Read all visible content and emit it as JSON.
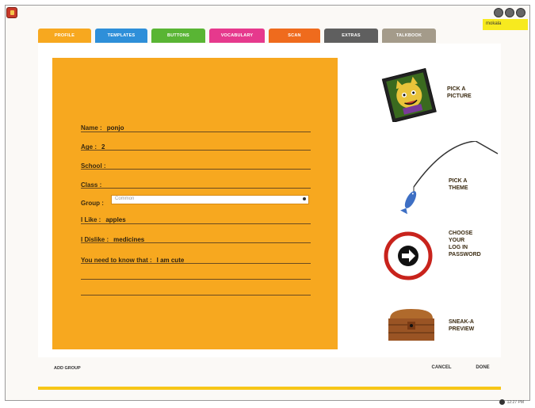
{
  "user": {
    "name": "mokala"
  },
  "tabs": [
    {
      "label": "PROFILE",
      "color": "#f7a81f"
    },
    {
      "label": "TEMPLATES",
      "color": "#2e8fd9"
    },
    {
      "label": "BUTTONS",
      "color": "#59b534"
    },
    {
      "label": "VOCABULARY",
      "color": "#e6398d"
    },
    {
      "label": "SCAN",
      "color": "#ef6b1d"
    },
    {
      "label": "EXTRAS",
      "color": "#5f5f5f"
    },
    {
      "label": "TALKBOOK",
      "color": "#a49b8a"
    }
  ],
  "profile": {
    "name_label": "Name :",
    "name_value": "ponjo",
    "age_label": "Age :",
    "age_value": "2",
    "school_label": "School :",
    "school_value": "",
    "class_label": "Class :",
    "class_value": "",
    "group_label": "Group :",
    "group_value": "Common",
    "like_label": "I Like :",
    "like_value": "apples",
    "dislike_label": "I Dislike :",
    "dislike_value": "medicines",
    "know_label": "You need to know that :",
    "know_value": "I am cute"
  },
  "side": {
    "pick_picture": "PICK A\nPICTURE",
    "pick_theme": "PICK A\nTHEME",
    "password": "CHOOSE\nYOUR\nLOG IN\nPASSWORD",
    "preview": "SNEAK-A\nPREVIEW"
  },
  "footer": {
    "add_group": "ADD GROUP",
    "cancel": "CANCEL",
    "done": "DONE"
  },
  "status": {
    "time": "12:27 PM"
  }
}
